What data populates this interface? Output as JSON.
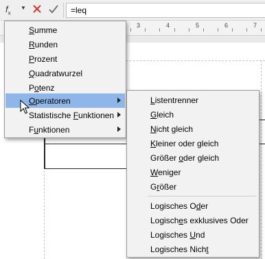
{
  "toolbar": {
    "fx_label": "f",
    "fx_sub": "x",
    "formula_value": "=leq"
  },
  "ruler": {
    "labels": [
      "3",
      "4",
      "5",
      "6",
      "7"
    ]
  },
  "insert_menu": {
    "items": [
      {
        "label": "Summe",
        "mnemonic": "S"
      },
      {
        "label": "Runden",
        "mnemonic": "R"
      },
      {
        "label": "Prozent",
        "mnemonic": "P"
      },
      {
        "label": "Quadratwurzel",
        "mnemonic": "Q"
      },
      {
        "label": "Potenz",
        "mnemonic": "o"
      },
      {
        "label": "Operatoren",
        "mnemonic": "O",
        "submenu": true,
        "active": true
      },
      {
        "label": "Statistische Funktionen",
        "mnemonic": "F",
        "submenu": true
      },
      {
        "label": "Funktionen",
        "mnemonic": "u",
        "submenu": true
      }
    ]
  },
  "operators_menu": {
    "group1": [
      {
        "label": "Listentrenner",
        "mnemonic": "L"
      },
      {
        "label": "Gleich",
        "mnemonic": "G"
      },
      {
        "label": "Nicht gleich",
        "mnemonic": "N"
      },
      {
        "label": "Kleiner oder gleich",
        "mnemonic": "K"
      },
      {
        "label": "Größer oder gleich",
        "mnemonic": "o"
      },
      {
        "label": "Weniger",
        "mnemonic": "W"
      },
      {
        "label": "Größer",
        "mnemonic": "r"
      }
    ],
    "group2": [
      {
        "label": "Logisches Oder",
        "mnemonic": "d"
      },
      {
        "label": "Logisches exklusives Oder",
        "mnemonic": "e"
      },
      {
        "label": "Logisches Und",
        "mnemonic": "U"
      },
      {
        "label": "Logisches Nicht",
        "mnemonic": "t"
      }
    ]
  },
  "colors": {
    "highlight": "#8eb6e8",
    "menu_bg": "#f2f2f2",
    "cancel_red": "#d9342b"
  },
  "icons": {
    "cancel": "x-icon",
    "accept": "check-icon",
    "submenu": "chevron-right-icon",
    "cursor": "mouse-pointer-icon"
  }
}
